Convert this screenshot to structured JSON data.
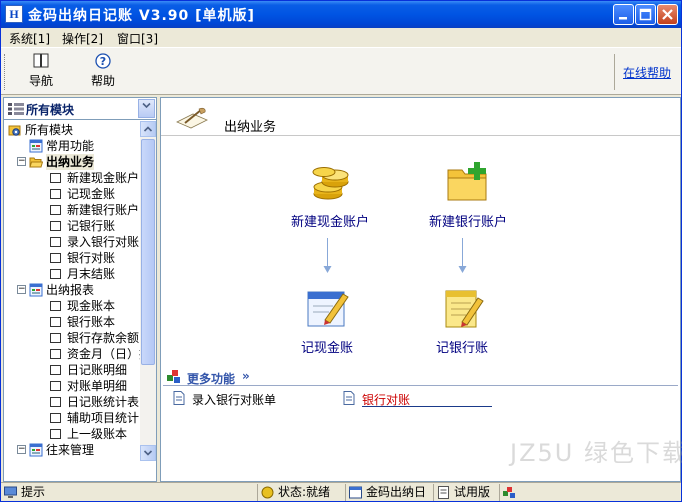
{
  "window": {
    "title": "金码出纳日记账 V3.90 [单机版]",
    "app_icon_text": "H"
  },
  "menubar": {
    "items": [
      "系统[1]",
      "操作[2]",
      "窗口[3]"
    ]
  },
  "toolbar": {
    "nav_label": "导航",
    "help_label": "帮助",
    "online_help": "在线帮助"
  },
  "left_panel": {
    "title": "所有模块",
    "tree": [
      {
        "label": "所有模块",
        "level": 0,
        "icon": "gear-folder-icon",
        "toggle": "none"
      },
      {
        "label": "常用功能",
        "level": 1,
        "icon": "module-icon",
        "toggle": "none"
      },
      {
        "label": "出纳业务",
        "level": 1,
        "icon": "folder-open-icon",
        "toggle": "minus",
        "bold": true,
        "selected": true
      },
      {
        "label": "新建现金账户",
        "level": 2,
        "icon": "checkbox-icon"
      },
      {
        "label": "记现金账",
        "level": 2,
        "icon": "checkbox-icon"
      },
      {
        "label": "新建银行账户",
        "level": 2,
        "icon": "checkbox-icon"
      },
      {
        "label": "记银行账",
        "level": 2,
        "icon": "checkbox-icon"
      },
      {
        "label": "录入银行对账",
        "level": 2,
        "icon": "checkbox-icon"
      },
      {
        "label": "银行对账",
        "level": 2,
        "icon": "checkbox-icon"
      },
      {
        "label": "月末结账",
        "level": 2,
        "icon": "checkbox-icon"
      },
      {
        "label": "出纳报表",
        "level": 1,
        "icon": "module-icon",
        "toggle": "minus"
      },
      {
        "label": "现金账本",
        "level": 2,
        "icon": "checkbox-icon"
      },
      {
        "label": "银行账本",
        "level": 2,
        "icon": "checkbox-icon"
      },
      {
        "label": "银行存款余额",
        "level": 2,
        "icon": "checkbox-icon"
      },
      {
        "label": "资金月（日）报",
        "level": 2,
        "icon": "checkbox-icon"
      },
      {
        "label": "日记账明细",
        "level": 2,
        "icon": "checkbox-icon"
      },
      {
        "label": "对账单明细",
        "level": 2,
        "icon": "checkbox-icon"
      },
      {
        "label": "日记账统计表",
        "level": 2,
        "icon": "checkbox-icon"
      },
      {
        "label": "辅助项目统计",
        "level": 2,
        "icon": "checkbox-icon"
      },
      {
        "label": "上一级账本",
        "level": 2,
        "icon": "checkbox-icon"
      },
      {
        "label": "往来管理",
        "level": 1,
        "icon": "module-icon",
        "toggle": "minus"
      }
    ]
  },
  "main": {
    "section_title": "出纳业务",
    "functions": [
      {
        "label": "新建现金账户",
        "icon": "coins-icon"
      },
      {
        "label": "新建银行账户",
        "icon": "folder-add-icon"
      },
      {
        "label": "记现金账",
        "icon": "edit-window-icon"
      },
      {
        "label": "记银行账",
        "icon": "notepad-pencil-icon"
      }
    ],
    "more_label": "更多功能",
    "more_chevron": "»",
    "more_links": [
      {
        "label": "录入银行对账单",
        "active": false
      },
      {
        "label": "银行对账",
        "active": true
      }
    ],
    "watermark": "JZ5U 绿色下载"
  },
  "statusbar": {
    "hint": "提示",
    "status": "状态:就绪",
    "app_name": "金码出纳日",
    "edition": "试用版"
  }
}
